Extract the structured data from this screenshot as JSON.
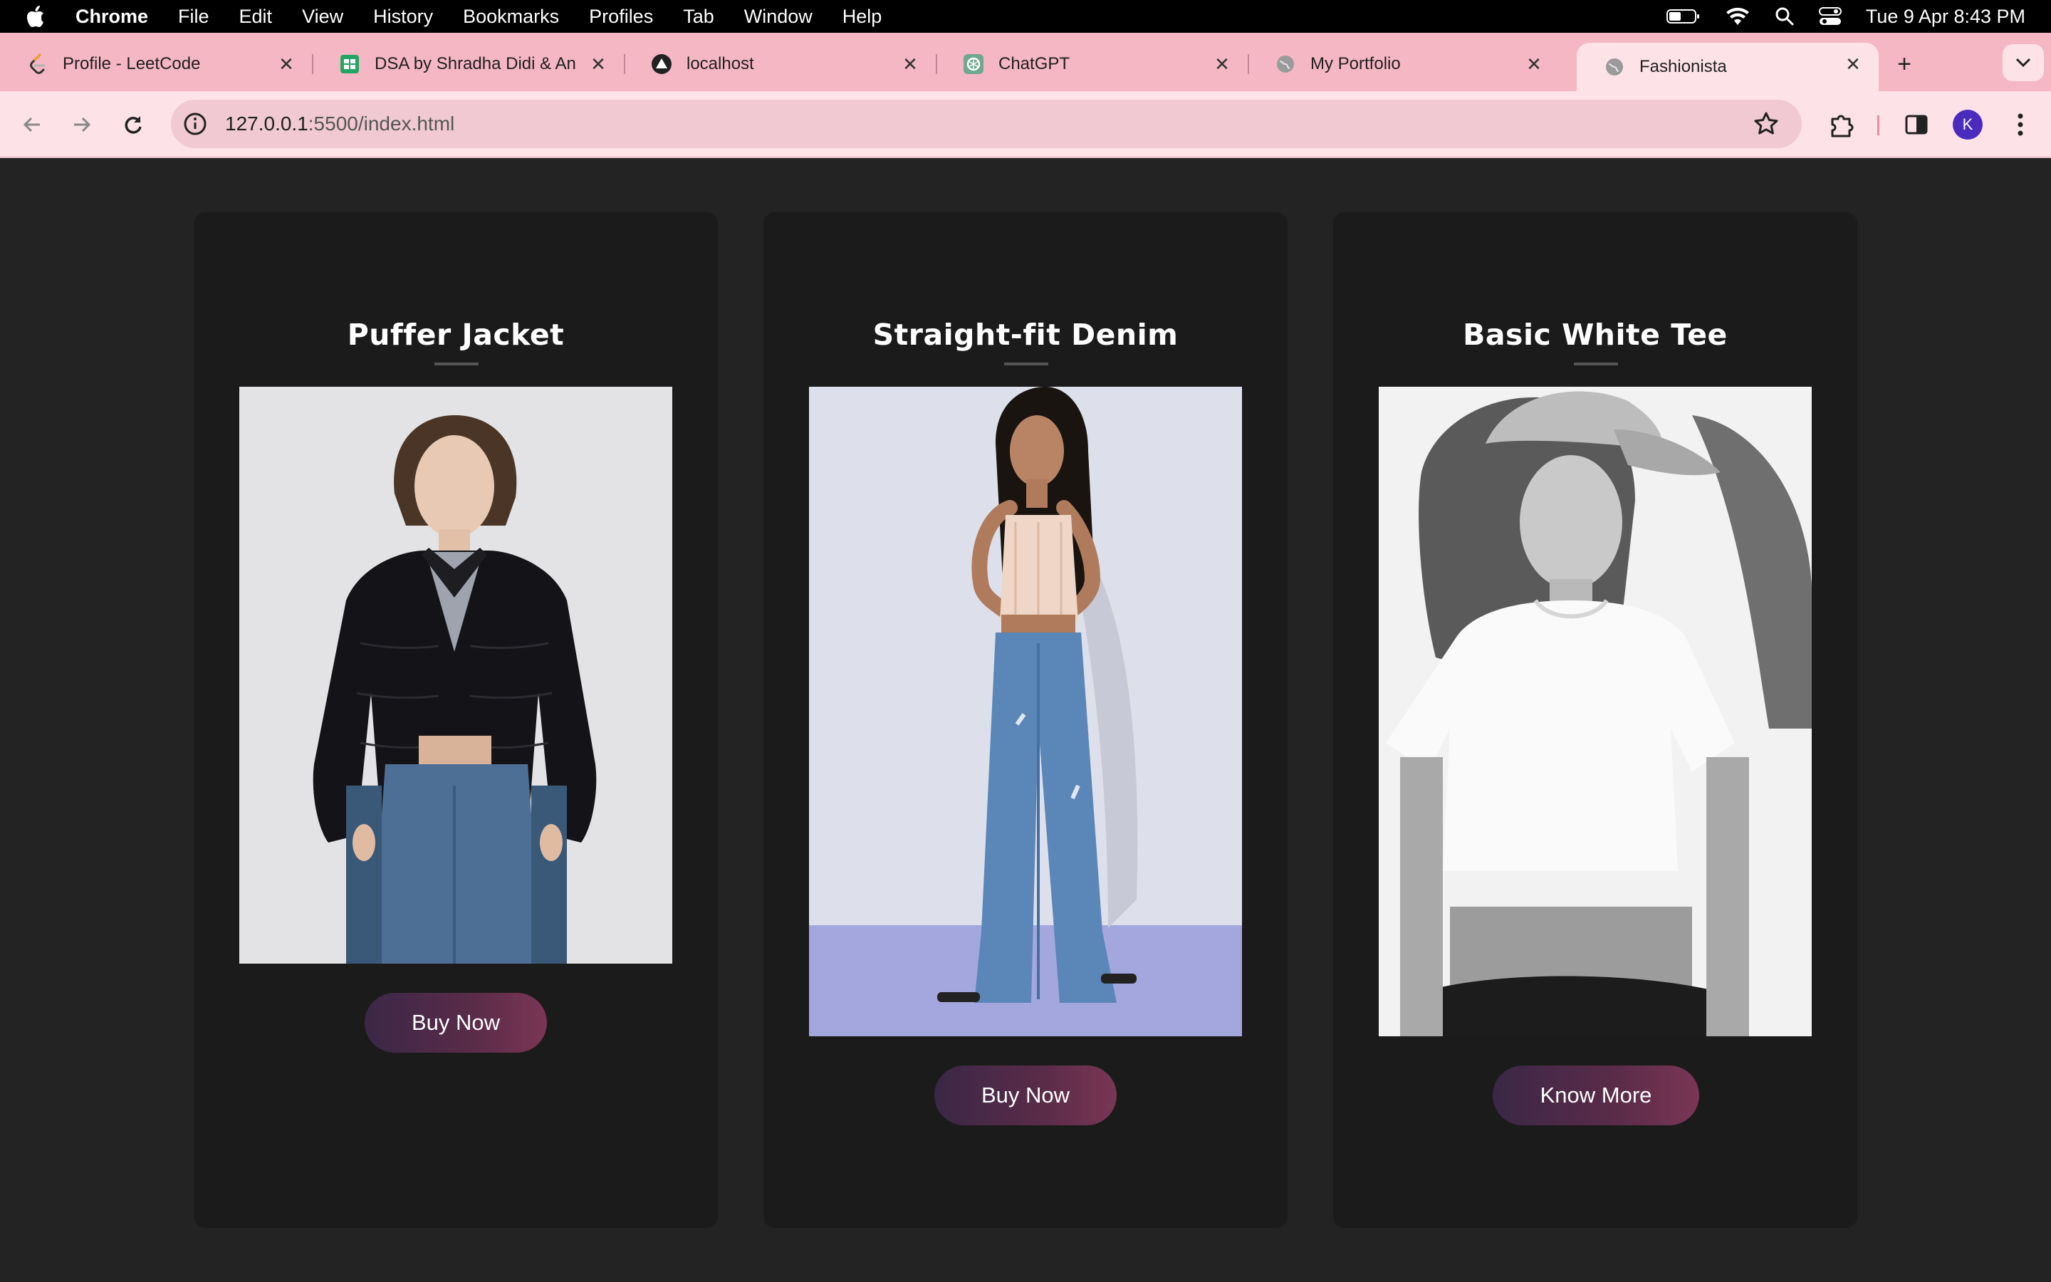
{
  "menubar": {
    "app_name": "Chrome",
    "items": [
      "File",
      "Edit",
      "View",
      "History",
      "Bookmarks",
      "Profiles",
      "Tab",
      "Window",
      "Help"
    ],
    "clock": "Tue 9 Apr  8:43 PM"
  },
  "tabs": [
    {
      "title": "Profile - LeetCode",
      "icon": "leetcode-icon",
      "active": false
    },
    {
      "title": "DSA by Shradha Didi & An",
      "icon": "sheets-icon",
      "active": false
    },
    {
      "title": "localhost",
      "icon": "triangle-logo-icon",
      "active": false
    },
    {
      "title": "ChatGPT",
      "icon": "chatgpt-icon",
      "active": false
    },
    {
      "title": "My Portfolio",
      "icon": "globe-icon",
      "active": false
    },
    {
      "title": "Fashionista",
      "icon": "globe-icon",
      "active": true
    }
  ],
  "toolbar": {
    "url_host": "127.0.0.1",
    "url_path": ":5500/index.html",
    "profile_initial": "K"
  },
  "products": [
    {
      "title": "Puffer Jacket",
      "button": "Buy Now",
      "image": "woman-in-black-puffer-jacket-and-jeans"
    },
    {
      "title": "Straight-fit Denim",
      "button": "Buy Now",
      "image": "woman-in-lace-top-and-wide-leg-jeans"
    },
    {
      "title": "Basic White Tee",
      "button": "Know More",
      "image": "woman-in-white-tee-and-cap-bw"
    }
  ],
  "colors": {
    "page_bg": "#232323",
    "card_bg": "#1b1b1b",
    "tabstrip_bg": "#f5b7c3",
    "toolbar_bg": "#fde2e8",
    "button_gradient_start": "#3b2747",
    "button_gradient_end": "#7a3655"
  }
}
